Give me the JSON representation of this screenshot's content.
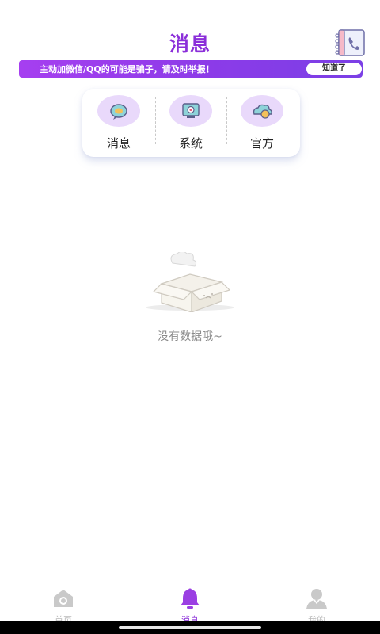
{
  "header": {
    "title": "消息"
  },
  "notice": {
    "text": "主动加微信/QQ的可能是骗子，请及时举报！",
    "button_label": "知道了"
  },
  "categories": [
    {
      "label": "消息",
      "icon": "chat-bubble-icon"
    },
    {
      "label": "系统",
      "icon": "system-monitor-icon"
    },
    {
      "label": "官方",
      "icon": "official-cloud-icon"
    }
  ],
  "empty_state": {
    "text": "没有数据哦~",
    "icon": "empty-box-icon"
  },
  "tabbar": [
    {
      "label": "首页",
      "icon": "home-icon",
      "active": false
    },
    {
      "label": "消息",
      "icon": "bell-icon",
      "active": true
    },
    {
      "label": "我的",
      "icon": "profile-icon",
      "active": false
    }
  ],
  "colors": {
    "accent": "#8b2fd9",
    "notice_gradient_start": "#a63ff0",
    "notice_gradient_end": "#7b3fe6",
    "inactive_tab": "#b9b9b9",
    "empty_text": "#8a8a8a"
  }
}
